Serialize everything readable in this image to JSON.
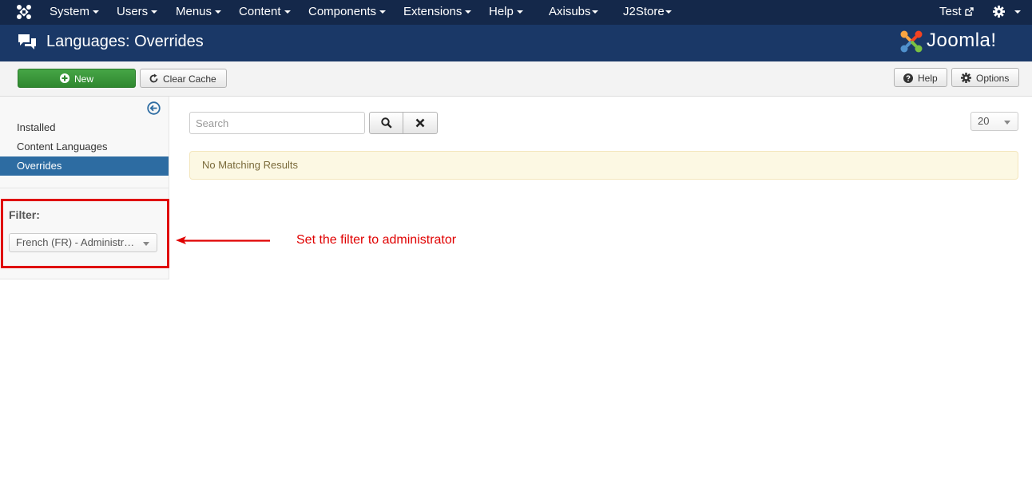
{
  "topnav": {
    "menus": [
      "System",
      "Users",
      "Menus",
      "Content",
      "Components",
      "Extensions",
      "Help",
      "Axisubs",
      "J2Store"
    ],
    "user": "Test"
  },
  "header": {
    "title": "Languages: Overrides"
  },
  "brand": {
    "logo_text": "Joomla!"
  },
  "toolbar": {
    "new_label": "New",
    "clear_cache_label": "Clear Cache",
    "help_label": "Help",
    "options_label": "Options"
  },
  "sidebar": {
    "items": [
      {
        "label": "Installed",
        "active": false
      },
      {
        "label": "Content Languages",
        "active": false
      },
      {
        "label": "Overrides",
        "active": true
      }
    ],
    "filter_label": "Filter:",
    "filter_value": "French (FR) - Administr…"
  },
  "main": {
    "search_placeholder": "Search",
    "limit_value": "20",
    "alert": "No Matching Results"
  },
  "annotation": {
    "text": "Set the filter to administrator",
    "color": "#e00000"
  },
  "colors": {
    "topnav": "#14284a",
    "header": "#1a3867",
    "active": "#2d6ca2",
    "new_button": "#3d9a3d"
  }
}
